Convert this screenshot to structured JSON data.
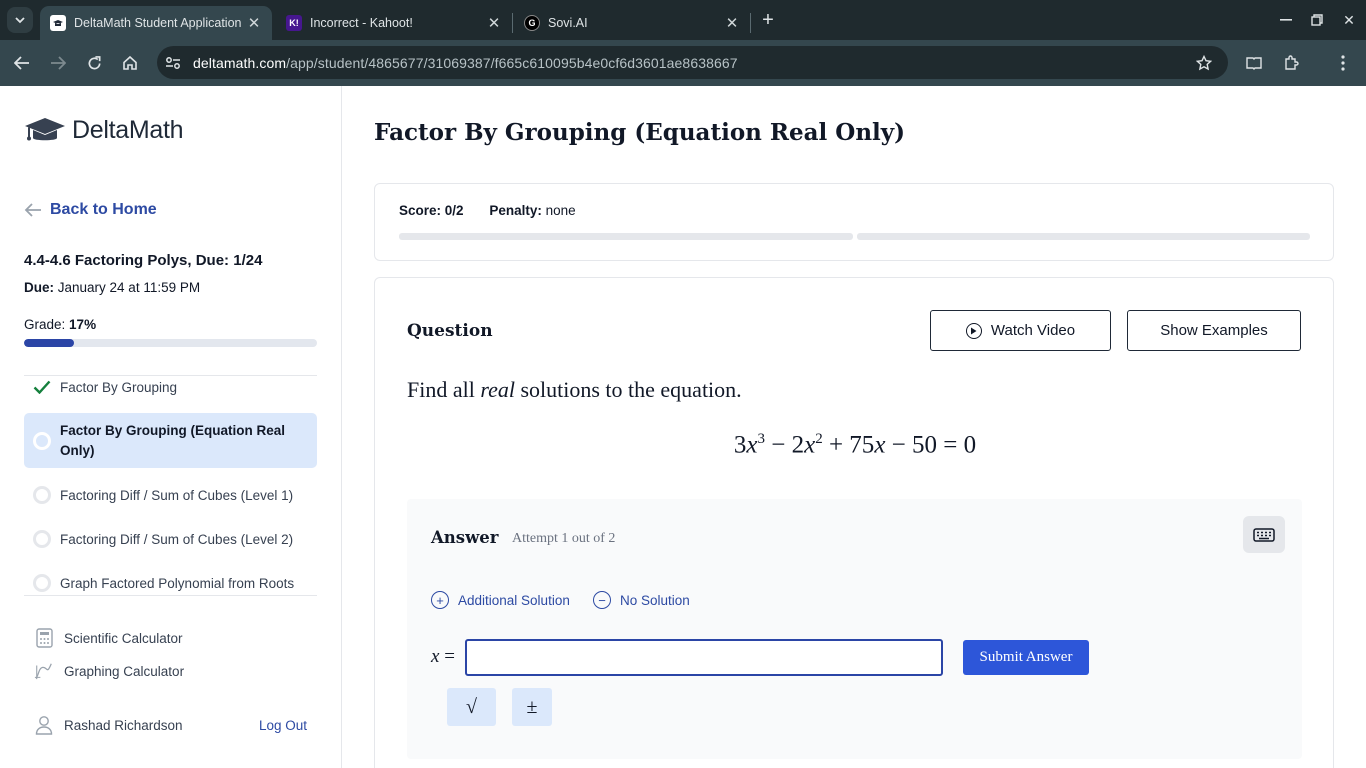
{
  "browser": {
    "tabs": [
      {
        "title": "DeltaMath Student Application",
        "active": true
      },
      {
        "title": "Incorrect - Kahoot!",
        "active": false
      },
      {
        "title": "Sovi.AI",
        "active": false
      }
    ],
    "url_host": "deltamath.com",
    "url_path": "/app/student/4865677/31069387/f665c610095b4e0cf6d3601ae8638667"
  },
  "sidebar": {
    "brand": "DeltaMath",
    "back_label": "Back to Home",
    "assignment_title": "4.4-4.6 Factoring Polys, Due: 1/24",
    "due_label": "Due:",
    "due_value": "January 24 at 11:59 PM",
    "grade_label": "Grade:",
    "grade_value": "17%",
    "grade_fraction": 0.17,
    "skills": [
      {
        "label": "Factor By Grouping",
        "status": "done"
      },
      {
        "label": "Factor By Grouping (Equation Real Only)",
        "status": "active"
      },
      {
        "label": "Factoring Diff / Sum of Cubes (Level 1)",
        "status": "todo"
      },
      {
        "label": "Factoring Diff / Sum of Cubes (Level 2)",
        "status": "todo"
      },
      {
        "label": "Graph Factored Polynomial from Roots",
        "status": "todo"
      }
    ],
    "tools": {
      "scientific": "Scientific Calculator",
      "graphing": "Graphing Calculator"
    },
    "user_name": "Rashad Richardson",
    "logout_label": "Log Out"
  },
  "main": {
    "title": "Factor By Grouping (Equation Real Only)",
    "score_label": "Score:",
    "score_value": "0/2",
    "penalty_label": "Penalty:",
    "penalty_value": "none",
    "question_label": "Question",
    "watch_video_label": "Watch Video",
    "show_examples_label": "Show Examples",
    "prompt_before": "Find all ",
    "prompt_em": "real",
    "prompt_after": " solutions to the equation.",
    "answer": {
      "label": "Answer",
      "attempt": "Attempt 1 out of 2",
      "additional_solution": "Additional Solution",
      "no_solution": "No Solution",
      "variable": "x",
      "input_value": "",
      "submit_label": "Submit Answer",
      "sqrt_symbol": "√",
      "pm_symbol": "±"
    }
  },
  "colors": {
    "accent_blue": "#2b45a6",
    "submit_blue": "#2d56d9",
    "active_skill_bg": "#dbe8fb",
    "check_green": "#15803d"
  }
}
